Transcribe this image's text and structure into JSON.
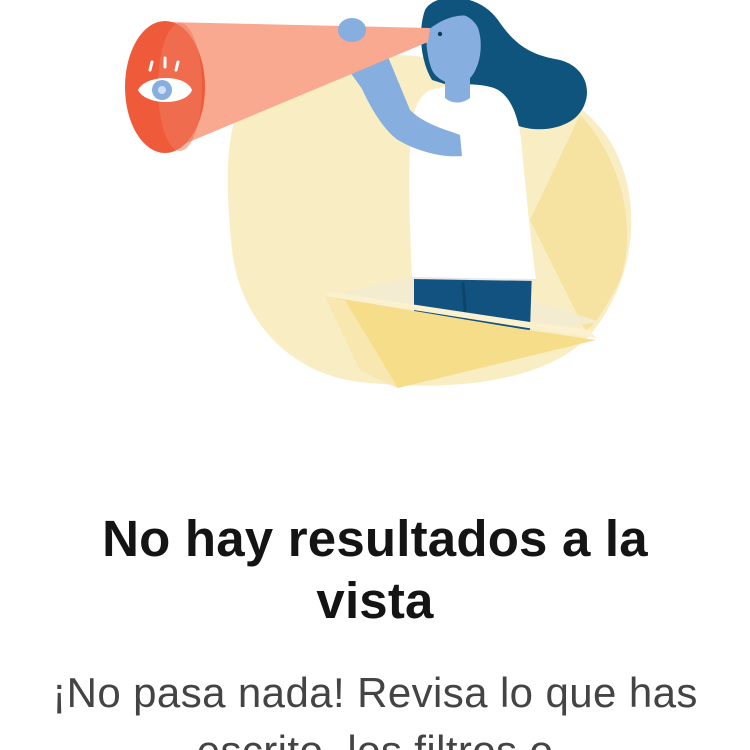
{
  "empty_state": {
    "illustration_icon": "person-looking-through-telescope",
    "eye_icon": "eye-icon",
    "title": "No hay resultados a la vista",
    "message": "¡No pasa nada! Revisa lo que has escrito, los filtros o"
  },
  "colors": {
    "background": "#FFFFFF",
    "title_text": "#141414",
    "message_text": "#444444",
    "telescope_cone": "#F8A98F",
    "telescope_lens": "#EF5B3A",
    "skin": "#86AEDE",
    "hair": "#0F547C",
    "pants": "#125280",
    "blob_yellow": "#F9EDC3",
    "box_yellow": "#F5DD8A"
  }
}
